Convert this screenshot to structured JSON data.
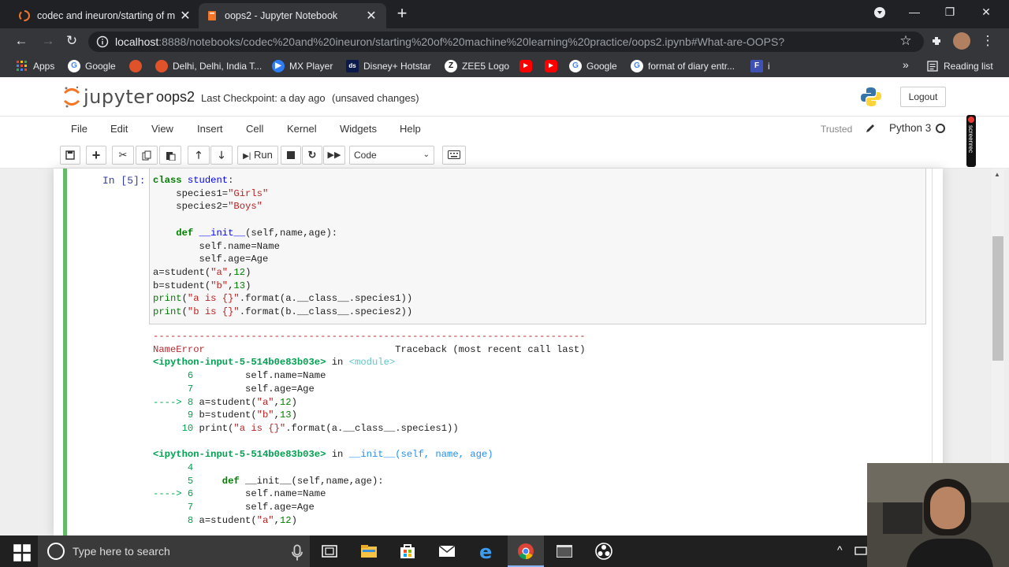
{
  "browser": {
    "tabs": [
      {
        "title": "codec and ineuron/starting of m",
        "active": false
      },
      {
        "title": "oops2 - Jupyter Notebook",
        "active": true
      }
    ],
    "new_tab": "+",
    "window_controls": {
      "minimize": "—",
      "maximize": "❐",
      "close": "✕"
    },
    "address": {
      "host": "localhost",
      "rest": ":8888/notebooks/codec%20and%20ineuron/starting%20of%20machine%20learning%20practice/oops2.ipynb#What-are-OOPS?"
    },
    "bookmarks": [
      {
        "label": "Apps",
        "icon": "apps-grid-icon"
      },
      {
        "label": "Google",
        "icon": "google-icon"
      },
      {
        "label": "",
        "icon": "orange-site-icon"
      },
      {
        "label": "Delhi, Delhi, India T...",
        "icon": "orange-site-icon"
      },
      {
        "label": "MX Player",
        "icon": "mx-player-icon"
      },
      {
        "label": "Disney+ Hotstar",
        "icon": "hotstar-icon"
      },
      {
        "label": "ZEE5 Logo",
        "icon": "zee5-icon"
      },
      {
        "label": "",
        "icon": "youtube-icon"
      },
      {
        "label": "",
        "icon": "youtube-icon"
      },
      {
        "label": "Google",
        "icon": "google-icon"
      },
      {
        "label": "format of diary entr...",
        "icon": "google-icon"
      },
      {
        "label": "i",
        "icon": "f-icon"
      }
    ],
    "more_bookmarks": "»",
    "reading_list": "Reading list"
  },
  "jupyter": {
    "logo_text": "jupyter",
    "notebook_name": "oops2",
    "checkpoint": "Last Checkpoint: a day ago",
    "unsaved": "(unsaved changes)",
    "logout": "Logout",
    "menu": [
      "File",
      "Edit",
      "View",
      "Insert",
      "Cell",
      "Kernel",
      "Widgets",
      "Help"
    ],
    "trusted": "Trusted",
    "kernel": "Python 3",
    "toolbar": {
      "run": "Run",
      "cell_type": "Code"
    }
  },
  "cell": {
    "prompt": "In [5]:"
  },
  "taskbar": {
    "search_placeholder": "Type here to search"
  },
  "overlay": {
    "screenrec_label": "screenrec"
  }
}
